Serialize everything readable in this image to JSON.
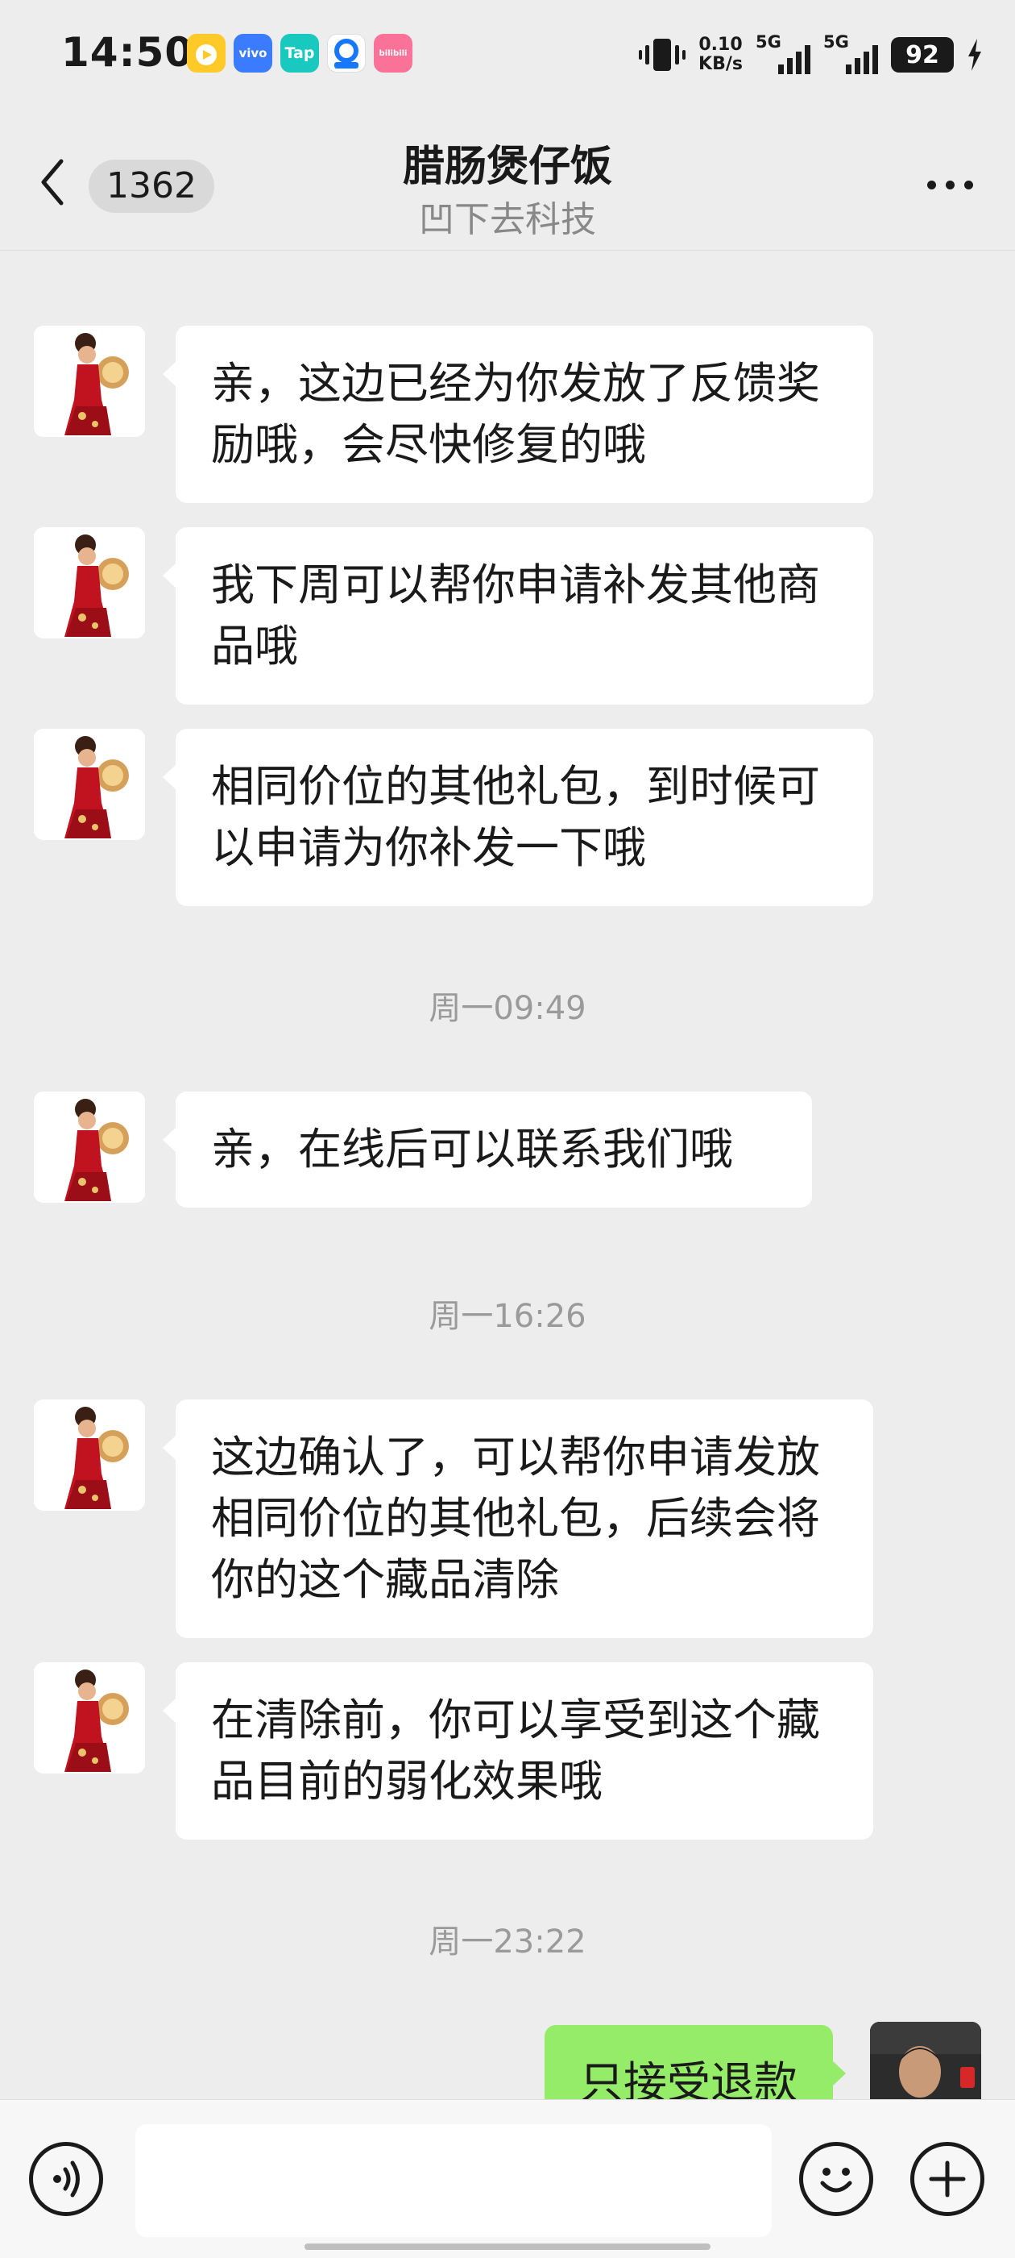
{
  "status_bar": {
    "time": "14:50",
    "app_icons": [
      {
        "name": "yellow-app-icon",
        "label": "",
        "color": "#ffc928"
      },
      {
        "name": "vivo-app-icon",
        "label": "vivo",
        "color": "#3a7bff"
      },
      {
        "name": "taptap-app-icon",
        "label": "Tap",
        "color": "#19c9c0"
      },
      {
        "name": "blue-app-icon",
        "label": "",
        "color": "#1677ff"
      },
      {
        "name": "bilibili-app-icon",
        "label": "bilibili",
        "color": "#fb7299"
      }
    ],
    "net_speed_value": "0.10",
    "net_speed_unit": "KB/s",
    "signal_1_label": "5G",
    "signal_2_label": "5G",
    "battery": "92"
  },
  "header": {
    "unread_count": "1362",
    "title": "腊肠煲仔饭",
    "subtitle": "凹下去科技"
  },
  "messages": [
    {
      "text": "亲，这边已经为你发放了反馈奖励哦，会尽快修复的哦"
    },
    {
      "text": "我下周可以帮你申请补发其他商品哦"
    },
    {
      "text": "相同价位的其他礼包，到时候可以申请为你补发一下哦"
    },
    {
      "text": "亲，在线后可以联系我们哦"
    },
    {
      "text": "这边确认了，可以帮你申请发放相同价位的其他礼包，后续会将你的这个藏品清除"
    },
    {
      "text": "在清除前，你可以享受到这个藏品目前的弱化效果哦"
    }
  ],
  "timestamps": [
    "周一09:49",
    "周一16:26",
    "周一23:22"
  ],
  "self_message": {
    "text": "只接受退款"
  },
  "colors": {
    "background": "#ededed",
    "bubble_incoming": "#ffffff",
    "bubble_outgoing": "#95ec69",
    "timestamp_text": "#9a9a9a"
  }
}
